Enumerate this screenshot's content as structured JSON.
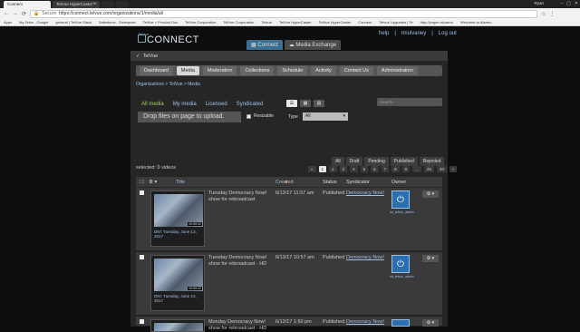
{
  "browser": {
    "tabs": [
      "Connect",
      "TelVue HyperCaster™",
      "",
      ""
    ],
    "user": "Ryan",
    "url_secure": "Secure",
    "url": "https://connect.telvue.com/organizations/1/media/all",
    "bookmarks": [
      "Apps",
      "My Drive - Google",
      "general | TelVue Slack",
      "Salesforce - Enterprise",
      "TelVue > Product Doc",
      "TelVue Corporation",
      "TelVue Corporation",
      "Telvue",
      "TelVue HyperCaster",
      "TelVue HyperCaster",
      "Connect",
      "Telvue Upgrades | Te",
      "http://jorgen.nkzamo",
      "Welcome to Alarmo"
    ]
  },
  "header": {
    "logo_small": "TelVue",
    "logo_big": "CONNECT",
    "links": [
      "help",
      "tmulvaney",
      "Log out"
    ],
    "app_tabs": [
      "Connect",
      "Media Exchange"
    ]
  },
  "panel": {
    "org_name": "TelVue",
    "nav": [
      "Dashboard",
      "Media",
      "Moderation",
      "Collections",
      "Schedule",
      "Activity",
      "Contact Us",
      "Administration"
    ],
    "breadcrumb": "Organizations > TelVue > Media",
    "subtabs": [
      "All media",
      "My media",
      "Licensed",
      "Syndicated"
    ],
    "view_icons": [
      "list-view-icon",
      "grid-view-icon",
      "detail-view-icon"
    ],
    "search_placeholder": "Search",
    "dropzone": "Drop files on page to upload.",
    "resizable_label": "Resizable",
    "type_label": "Type",
    "type_value": "All",
    "filters": [
      "All",
      "Draft",
      "Pending",
      "Published",
      "Rejected"
    ],
    "selected_text": "selected: 0 videos",
    "pager": [
      "1",
      "2",
      "3",
      "4",
      "5",
      "6",
      "7",
      "8",
      "9",
      "...",
      "29",
      "30"
    ],
    "columns": [
      "Title",
      "Created",
      "Status",
      "Syndicator",
      "Owner"
    ]
  },
  "rows": [
    {
      "thumb_caption": "DN!: Tuesday, June 13, 2017",
      "duration": "00:59:02",
      "title": "Tuesday Democracy Now! show for rebroadcast",
      "created": "6/13/17 11:57 am",
      "status": "Published",
      "syndicator": "Democracy Now!",
      "owner": "dn_telvue_admin"
    },
    {
      "thumb_caption": "DN!: Tuesday, June 13, 2017",
      "duration": "00:59:02",
      "title": "Tuesday Democracy Now! show for rebroadcast - HD",
      "created": "6/13/17 10:57 am",
      "status": "Published",
      "syndicator": "Democracy Now!",
      "owner": "dn_telvue_admin"
    },
    {
      "thumb_caption": "",
      "duration": "",
      "title": "Monday Democracy Now! show for rebroadcast - HD",
      "created": "6/12/17 1:50 pm",
      "status": "Published",
      "syndicator": "Democracy Now!",
      "owner": "dn_telvue_admin"
    }
  ]
}
